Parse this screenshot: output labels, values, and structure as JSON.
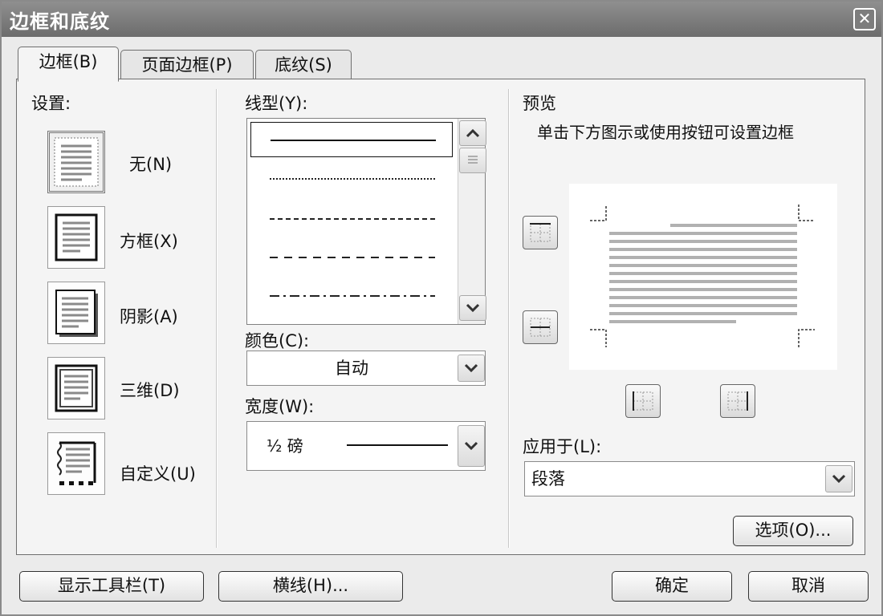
{
  "dialog": {
    "title": "边框和底纹",
    "close_symbol": "✕"
  },
  "tabs": [
    {
      "label": "边框(B)",
      "active": true
    },
    {
      "label": "页面边框(P)",
      "active": false
    },
    {
      "label": "底纹(S)",
      "active": false
    }
  ],
  "settings": {
    "label": "设置:",
    "items": [
      {
        "label": "无(N)",
        "icon": "border-none-icon",
        "selected": true
      },
      {
        "label": "方框(X)",
        "icon": "border-box-icon",
        "selected": false
      },
      {
        "label": "阴影(A)",
        "icon": "border-shadow-icon",
        "selected": false
      },
      {
        "label": "三维(D)",
        "icon": "border-3d-icon",
        "selected": false
      },
      {
        "label": "自定义(U)",
        "icon": "border-custom-icon",
        "selected": false
      }
    ]
  },
  "line_style": {
    "label": "线型(Y):",
    "styles": [
      "solid",
      "dotted",
      "dashed-short",
      "dashed",
      "dash-dot"
    ],
    "selected_index": 0
  },
  "color": {
    "label": "颜色(C):",
    "value": "自动"
  },
  "width": {
    "label": "宽度(W):",
    "value": "½ 磅"
  },
  "preview": {
    "label": "预览",
    "hint": "单击下方图示或使用按钮可设置边框"
  },
  "apply_to": {
    "label": "应用于(L):",
    "value": "段落"
  },
  "buttons": {
    "options": "选项(O)...",
    "show_toolbar": "显示工具栏(T)",
    "horizontal_line": "横线(H)...",
    "ok": "确定",
    "cancel": "取消"
  },
  "colors": {
    "titlebar": "#7a7a7a",
    "panel": "#f4f4f4",
    "preview_lines": "#b1b1b1"
  }
}
